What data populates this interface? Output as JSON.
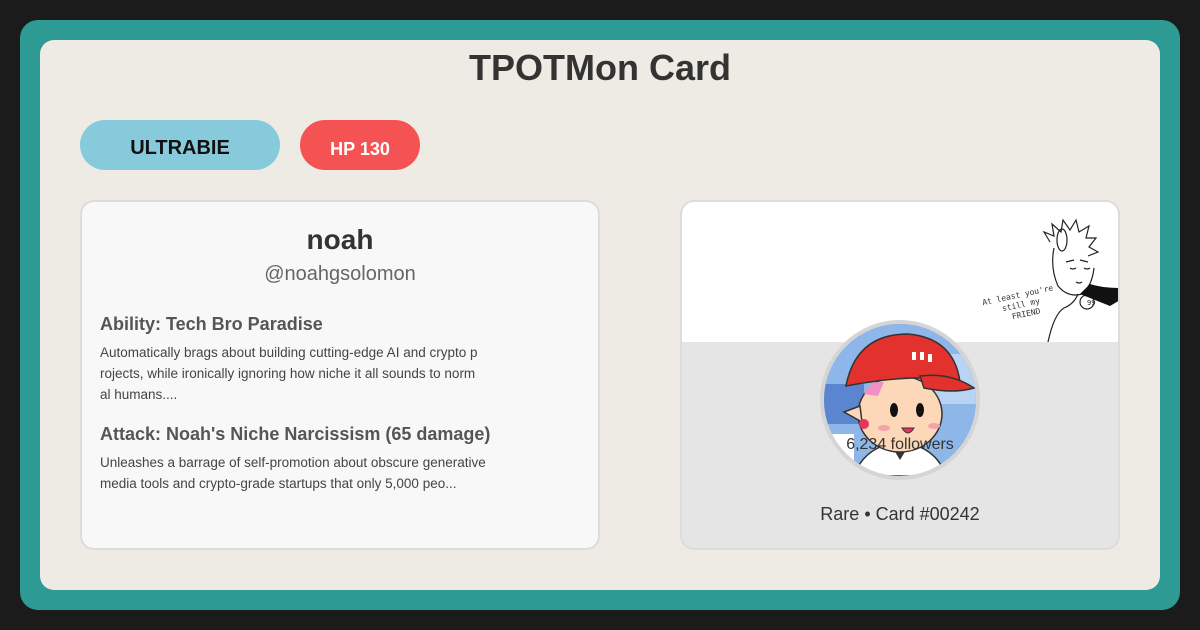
{
  "card": {
    "title": "TPOTMon Card",
    "type_label": "ULTRABIE",
    "hp_label": "HP 130"
  },
  "profile": {
    "name": "noah",
    "handle": "@noahgsolomon"
  },
  "ability": {
    "title": "Ability: Tech Bro Paradise",
    "text": "Automatically brags about building cutting-edge AI and crypto projects, while ironically ignoring how niche it all sounds to normal humans...."
  },
  "attack": {
    "title": "Attack: Noah's Niche Narcissism (65 damage)",
    "text": "Unleashes a barrage of self-promotion about obscure generative media tools and crypto-grade startups that only 5,000 peo..."
  },
  "stats": {
    "followers": "6,234 followers",
    "rarity": "Rare • Card #00242"
  },
  "banner": {
    "caption_lines": [
      "At least you're",
      "still my",
      "FRIEND"
    ]
  },
  "colors": {
    "frame": "#2e9a94",
    "card_bg": "#edebe4",
    "type_pill": "#86cadc",
    "hp_pill": "#f55353"
  }
}
